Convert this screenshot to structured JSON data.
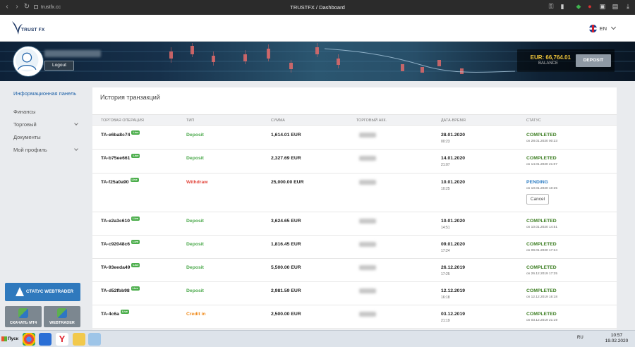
{
  "browser": {
    "url": "trustfx.cc",
    "title": "TRUSTFX / Dashboard"
  },
  "header": {
    "logo_text": "TRUST FX",
    "language": "EN"
  },
  "hero": {
    "logout_label": "Logout",
    "balance_amount": "EUR: 66,764.01",
    "balance_label": "BALANCE",
    "deposit_label": "DEPOSIT"
  },
  "sidebar": {
    "items": [
      {
        "label": "Информационная панель",
        "active": true,
        "has_children": false
      },
      {
        "label": "Финансы",
        "active": false,
        "has_children": false
      },
      {
        "label": "Торговый",
        "active": false,
        "has_children": true
      },
      {
        "label": "Документы",
        "active": false,
        "has_children": false
      },
      {
        "label": "Мой профиль",
        "active": false,
        "has_children": true
      }
    ],
    "webtrader_status_label": "СТАТУС WEBTRADER",
    "mt4_label": "СКАЧАТЬ MT4",
    "webtrader_label": "WEBTRADER"
  },
  "panel": {
    "title": "История транзакций",
    "columns": [
      "ТОРГОВАЯ ОПЕРАЦИЯ",
      "ТИП",
      "СУММА",
      "ТОРГОВЫЙ АКК.",
      "ДАТА-ВРЕМЯ",
      "СТАТУС"
    ],
    "live_badge": "Live",
    "cancel_label": "Cancel",
    "rows": [
      {
        "op": "TA-e6ba8c74",
        "type": "Deposit",
        "type_color": "green",
        "sum": "1,614.01 EUR",
        "date": "28.01.2020",
        "time": "00:23",
        "status": "COMPLETED",
        "status_kind": "completed",
        "status_sub": "on 28.01.2020 00:23"
      },
      {
        "op": "TA-b75ee661",
        "type": "Deposit",
        "type_color": "green",
        "sum": "2,327.69 EUR",
        "date": "14.01.2020",
        "time": "21:07",
        "status": "COMPLETED",
        "status_kind": "completed",
        "status_sub": "on 14.01.2020 21:07"
      },
      {
        "op": "TA-f25a0a90",
        "type": "Withdraw",
        "type_color": "red",
        "sum": "25,000.00 EUR",
        "date": "10.01.2020",
        "time": "10:25",
        "status": "PENDING",
        "status_kind": "pending",
        "status_sub": "on 10.01.2020 10:25"
      },
      {
        "op": "TA-e2a3c610",
        "type": "Deposit",
        "type_color": "green",
        "sum": "3,624.65 EUR",
        "date": "10.01.2020",
        "time": "14:51",
        "status": "COMPLETED",
        "status_kind": "completed",
        "status_sub": "on 10.01.2020 14:51"
      },
      {
        "op": "TA-c92048c6",
        "type": "Deposit",
        "type_color": "green",
        "sum": "1,816.45 EUR",
        "date": "09.01.2020",
        "time": "17:24",
        "status": "COMPLETED",
        "status_kind": "completed",
        "status_sub": "on 09.01.2020 17:24"
      },
      {
        "op": "TA-93eeda49",
        "type": "Deposit",
        "type_color": "green",
        "sum": "5,500.00 EUR",
        "date": "26.12.2019",
        "time": "17:25",
        "status": "COMPLETED",
        "status_kind": "completed",
        "status_sub": "on 26.12.2019 17:25"
      },
      {
        "op": "TA-d52fbb98",
        "type": "Deposit",
        "type_color": "green",
        "sum": "2,981.59 EUR",
        "date": "12.12.2019",
        "time": "16:18",
        "status": "COMPLETED",
        "status_kind": "completed",
        "status_sub": "on 12.12.2019 16:18"
      },
      {
        "op": "TA-4c6a",
        "type": "Credit in",
        "type_color": "orange",
        "sum": "2,500.00 EUR",
        "date": "03.12.2019",
        "time": "21:19",
        "status": "COMPLETED",
        "status_kind": "completed",
        "status_sub": "on 03.12.2019 21:19"
      }
    ]
  },
  "taskbar": {
    "start_label": "Пуск",
    "lang": "RU",
    "time": "10:57",
    "date": "19.02.2020"
  },
  "colors": {
    "accent": "#1f62a8",
    "deposit_green": "#4aa84a",
    "withdraw_red": "#e2463c",
    "credit_orange": "#f08b1c",
    "completed_green": "#3e7f24",
    "pending_blue": "#2f7ec4",
    "balance_gold": "#f0c63a"
  }
}
